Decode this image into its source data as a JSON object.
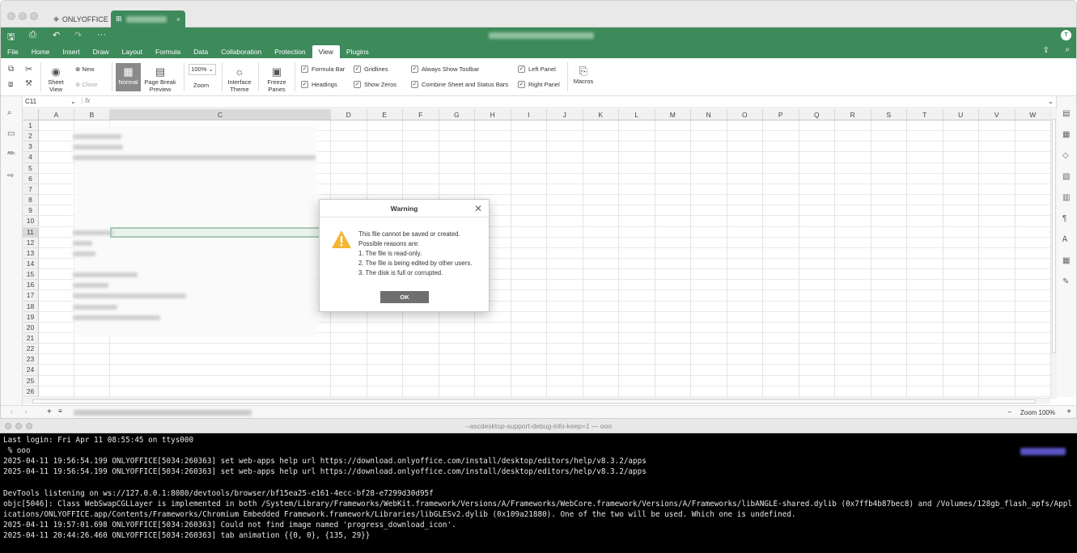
{
  "window": {
    "tab_onlyoffice": "ONLYOFFICE",
    "tab_doc_close": "×"
  },
  "quick_access": {
    "more": "···"
  },
  "user_initial": "T",
  "menu": [
    "File",
    "Home",
    "Insert",
    "Draw",
    "Layout",
    "Formula",
    "Data",
    "Collaboration",
    "Protection",
    "View",
    "Plugins"
  ],
  "menu_active_index": 9,
  "toolbar": {
    "sheet_view": "Sheet View",
    "new": "New",
    "close": "Close",
    "normal": "Normal",
    "page_break_preview": "Page Break Preview",
    "zoom_value": "100%",
    "zoom": "Zoom",
    "interface_theme": "Interface Theme",
    "freeze_panes": "Freeze Panes",
    "macros": "Macros",
    "checks": [
      {
        "label": "Formula Bar",
        "checked": true
      },
      {
        "label": "Headings",
        "checked": true
      },
      {
        "label": "Gridlines",
        "checked": true
      },
      {
        "label": "Show Zeros",
        "checked": true
      },
      {
        "label": "Always Show Toolbar",
        "checked": true
      },
      {
        "label": "Combine Sheet and Status Bars",
        "checked": true
      },
      {
        "label": "Left Panel",
        "checked": true
      },
      {
        "label": "Right Panel",
        "checked": true
      }
    ]
  },
  "formula_bar": {
    "cell_ref": "C11",
    "fx": "fx"
  },
  "columns": [
    "A",
    "B",
    "C",
    "D",
    "E",
    "F",
    "G",
    "H",
    "I",
    "J",
    "K",
    "L",
    "M",
    "N",
    "O",
    "P",
    "Q",
    "R",
    "S",
    "T",
    "U",
    "V",
    "W"
  ],
  "rows": [
    "1",
    "2",
    "3",
    "4",
    "5",
    "6",
    "7",
    "8",
    "9",
    "10",
    "11",
    "12",
    "13",
    "14",
    "15",
    "16",
    "17",
    "18",
    "19",
    "20",
    "21",
    "22",
    "23",
    "24",
    "25",
    "26"
  ],
  "selected_cell": "C11",
  "status": {
    "zoom": "Zoom 100%",
    "minus": "−",
    "plus": "+"
  },
  "dialog": {
    "title": "Warning",
    "lines": [
      "This file cannot be saved or created.",
      "Possible reasons are:",
      "1. The file is read-only.",
      "2. The file is being edited by other users.",
      "3. The disk is full or corrupted."
    ],
    "ok": "OK"
  },
  "terminal": {
    "title": "--ascdesktop-support-debug-info-keep=1 — ooo",
    "lines": [
      "Last login: Fri Apr 11 08:55:45 on ttys000",
      " % ooo",
      "2025-04-11 19:56:54.199 ONLYOFFICE[5034:260363] set web-apps help url https://download.onlyoffice.com/install/desktop/editors/help/v8.3.2/apps",
      "2025-04-11 19:56:54.199 ONLYOFFICE[5034:260363] set web-apps help url https://download.onlyoffice.com/install/desktop/editors/help/v8.3.2/apps",
      "",
      "DevTools listening on ws://127.0.0.1:8080/devtools/browser/bf15ea25-e161-4ecc-bf28-e7299d30d95f",
      "objc[5046]: Class WebSwapCGLLayer is implemented in both /System/Library/Frameworks/WebKit.framework/Versions/A/Frameworks/WebCore.framework/Versions/A/Frameworks/libANGLE-shared.dylib (0x7ffb4b87bec8) and /Volumes/128gb_flash_apfs/Appl",
      "ications/ONLYOFFICE.app/Contents/Frameworks/Chromium Embedded Framework.framework/Libraries/libGLESv2.dylib (0x109a21880). One of the two will be used. Which one is undefined.",
      "2025-04-11 19:57:01.698 ONLYOFFICE[5034:260363] Could not find image named 'progress_download_icon'.",
      "2025-04-11 20:44:26.460 ONLYOFFICE[5034:260363] tab animation {{0, 0}, {135, 29}}"
    ]
  }
}
